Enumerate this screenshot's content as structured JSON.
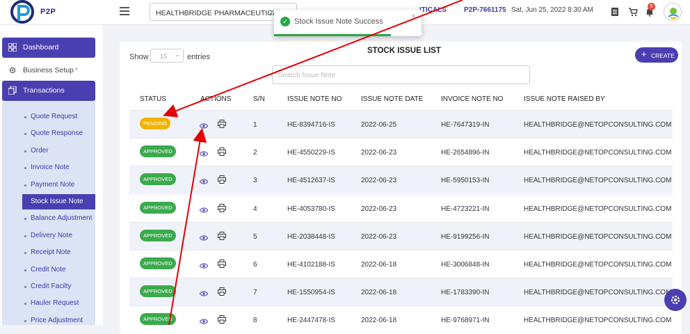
{
  "header": {
    "brand": "P2P",
    "company": "HEALTHBRIDGE PHARMACEUTICALS",
    "company_cut": "ITICALS",
    "p2p_id": "P2P-7661175",
    "datetime": "Sat, Jun 25, 2022 8:30 AM",
    "notification_count": "5",
    "icons": [
      "hamburger-icon",
      "document-icon",
      "cart-icon",
      "bell-icon",
      "user-avatar"
    ]
  },
  "toast": {
    "message": "Stock Issue Note Success",
    "close": "×"
  },
  "sidebar": {
    "dashboard": "Dashboard",
    "business_setup": "Business Setup",
    "transactions": "Transactions",
    "items": [
      "Quote Request",
      "Quote Response",
      "Order",
      "Invoice Note",
      "Payment Note",
      "Stock Issue Note",
      "Balance Adjustment",
      "Delivery Note",
      "Receipt Note",
      "Credit Note",
      "Credit Facilty",
      "Hauler Request",
      "Price Adjustment"
    ],
    "active_index": 5
  },
  "list": {
    "show_label": "Show",
    "entries_value": "15",
    "entries_label": "entries",
    "title": "STOCK ISSUE LIST",
    "create_label": "CREATE",
    "search_placeholder": "Search Issue Note",
    "columns": [
      "STATUS",
      "ACTIONS",
      "S/N",
      "ISSUE NOTE NO",
      "ISSUE NOTE DATE",
      "INVOICE NOTE NO",
      "ISSUE NOTE RAISED BY"
    ],
    "rows": [
      {
        "status": "PENDING",
        "sn": "1",
        "issue_no": "HE-8394716-IS",
        "date": "2022-06-25",
        "invoice_no": "HE-7647319-IN",
        "raised_by": "HEALTHBRIDGE@NETOPCONSULTING.COM"
      },
      {
        "status": "APPROVED",
        "sn": "2",
        "issue_no": "HE-4550229-IS",
        "date": "2022-06-23",
        "invoice_no": "HE-2654896-IN",
        "raised_by": "HEALTHBRIDGE@NETOPCONSULTING.COM"
      },
      {
        "status": "APPROVED",
        "sn": "3",
        "issue_no": "HE-4512637-IS",
        "date": "2022-06-23",
        "invoice_no": "HE-5950153-IN",
        "raised_by": "HEALTHBRIDGE@NETOPCONSULTING.COM"
      },
      {
        "status": "APPROVED",
        "sn": "4",
        "issue_no": "HE-4053780-IS",
        "date": "2022-06-23",
        "invoice_no": "HE-4723221-IN",
        "raised_by": "HEALTHBRIDGE@NETOPCONSULTING.COM"
      },
      {
        "status": "APPROVED",
        "sn": "5",
        "issue_no": "HE-2038448-IS",
        "date": "2022-06-23",
        "invoice_no": "HE-9199256-IN",
        "raised_by": "HEALTHBRIDGE@NETOPCONSULTING.COM"
      },
      {
        "status": "APPROVED",
        "sn": "6",
        "issue_no": "HE-4102188-IS",
        "date": "2022-06-18",
        "invoice_no": "HE-3006848-IN",
        "raised_by": "HEALTHBRIDGE@NETOPCONSULTING.COM"
      },
      {
        "status": "APPROVED",
        "sn": "7",
        "issue_no": "HE-1550954-IS",
        "date": "2022-06-18",
        "invoice_no": "HE-1783390-IN",
        "raised_by": "HEALTHBRIDGE@NETOPCONSULTING.COM"
      },
      {
        "status": "APPROVED",
        "sn": "8",
        "issue_no": "HE-2447478-IS",
        "date": "2022-06-18",
        "invoice_no": "HE-9768971-IN",
        "raised_by": "HEALTHBRIDGE@NETOPCONSULTING.COM"
      }
    ]
  },
  "colors": {
    "primary": "#4a3fb0",
    "pending": "#f0b400",
    "approved": "#3aaa4d",
    "success": "#28a745",
    "annotation": "#e30000"
  }
}
